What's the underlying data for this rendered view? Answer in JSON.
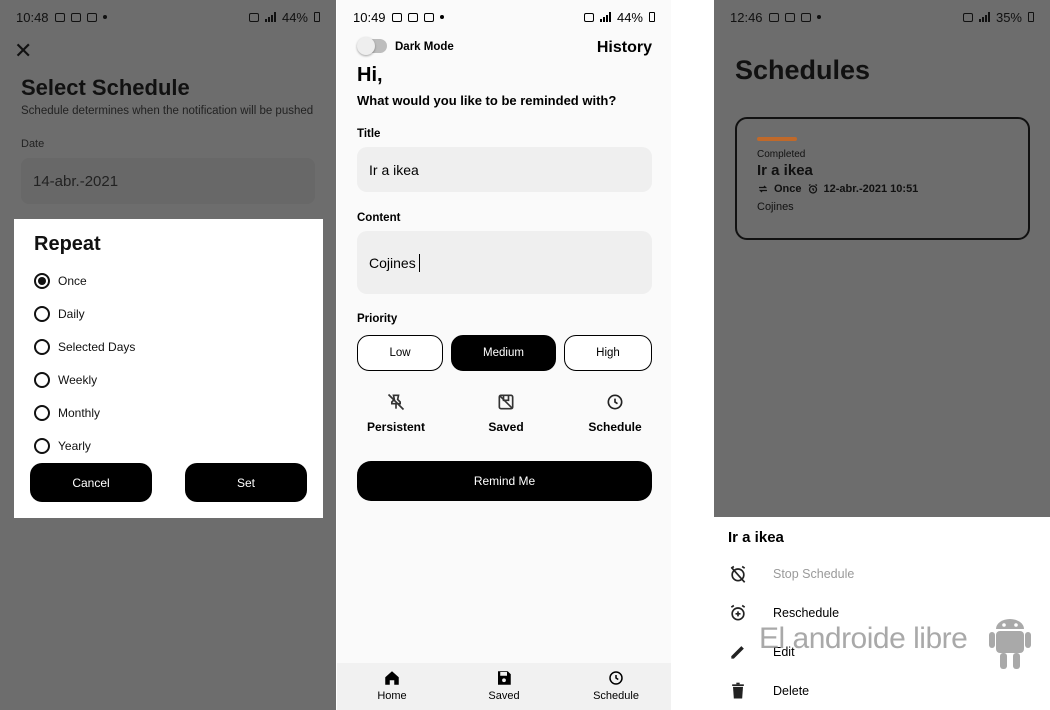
{
  "screen1": {
    "status": {
      "time": "10:48",
      "battery": "44%"
    },
    "title": "Select Schedule",
    "subtitle": "Schedule determines when the notification will be pushed",
    "date_label": "Date",
    "date_value": "14-abr.-2021",
    "dialog": {
      "title": "Repeat",
      "options": [
        "Once",
        "Daily",
        "Selected Days",
        "Weekly",
        "Monthly",
        "Yearly"
      ],
      "selected": "Once",
      "cancel": "Cancel",
      "set": "Set"
    }
  },
  "screen2": {
    "status": {
      "time": "10:49",
      "battery": "44%"
    },
    "dark_mode_label": "Dark Mode",
    "history": "History",
    "greeting": "Hi,",
    "question": "What would you like to be reminded with?",
    "title_label": "Title",
    "title_value": "Ir a ikea",
    "content_label": "Content",
    "content_value": "Cojines",
    "priority_label": "Priority",
    "priorities": [
      "Low",
      "Medium",
      "High"
    ],
    "selected_priority": "Medium",
    "options": [
      "Persistent",
      "Saved",
      "Schedule"
    ],
    "remind_button": "Remind Me",
    "nav": [
      "Home",
      "Saved",
      "Schedule"
    ]
  },
  "screen3": {
    "status": {
      "time": "12:46",
      "battery": "35%"
    },
    "title": "Schedules",
    "card": {
      "status": "Completed",
      "title": "Ir a ikea",
      "repeat": "Once",
      "datetime": "12-abr.-2021 10:51",
      "content": "Cojines"
    },
    "sheet": {
      "title": "Ir a ikea",
      "actions": [
        "Stop Schedule",
        "Reschedule",
        "Edit",
        "Delete"
      ]
    },
    "watermark": "El androide libre"
  },
  "colors": {
    "accent_bar": "#c0692a",
    "overlay": "#6d6d6d",
    "primary": "#000000"
  }
}
